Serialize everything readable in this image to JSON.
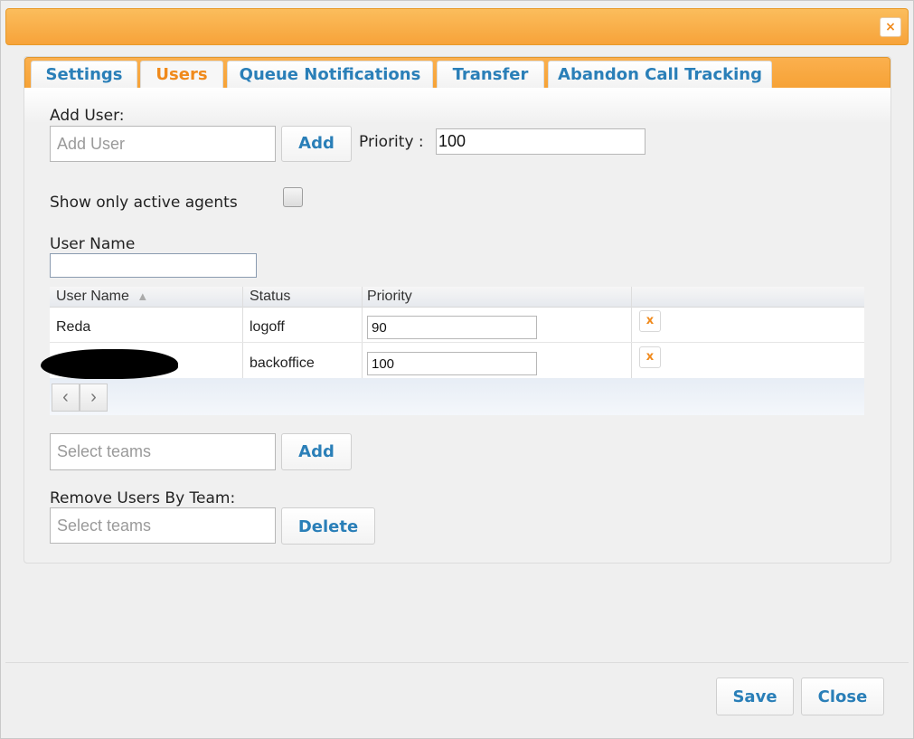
{
  "dialog": {
    "close_glyph": "×"
  },
  "tabs": [
    {
      "label": "Settings"
    },
    {
      "label": "Users"
    },
    {
      "label": "Queue Notifications"
    },
    {
      "label": "Transfer"
    },
    {
      "label": "Abandon Call Tracking"
    }
  ],
  "active_tab": "Users",
  "add_user": {
    "label": "Add User:",
    "placeholder": "Add User",
    "add_button": "Add",
    "priority_label": "Priority :",
    "priority_value": "100"
  },
  "active_agents": {
    "label": "Show only active agents",
    "checked": false
  },
  "filter": {
    "label": "User Name",
    "value": ""
  },
  "grid": {
    "columns": [
      "User Name",
      "Status",
      "Priority"
    ],
    "sort_indicator": "▲",
    "rows": [
      {
        "user": "Reda",
        "status": "logoff",
        "priority": "90",
        "delete": "x"
      },
      {
        "user": "",
        "status": "backoffice",
        "priority": "100",
        "delete": "x"
      }
    ],
    "pager": {
      "prev": "‹",
      "next": "›"
    }
  },
  "add_team": {
    "placeholder": "Select teams",
    "add_button": "Add"
  },
  "remove_team": {
    "label": "Remove Users By Team:",
    "placeholder": "Select teams",
    "delete_button": "Delete"
  },
  "footer": {
    "save": "Save",
    "close": "Close"
  },
  "colors": {
    "accent_orange": "#f7a33a",
    "link_blue": "#2a7fb8",
    "active_tab": "#f08a1c"
  }
}
